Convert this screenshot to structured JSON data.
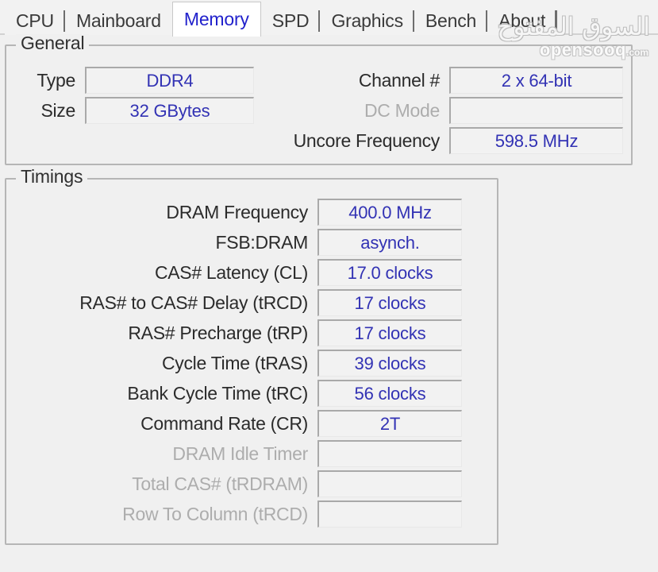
{
  "window": {
    "app": "CPU-Z",
    "active_tab": "Memory"
  },
  "tabs": [
    {
      "id": "cpu",
      "label": "CPU"
    },
    {
      "id": "mainboard",
      "label": "Mainboard"
    },
    {
      "id": "memory",
      "label": "Memory"
    },
    {
      "id": "spd",
      "label": "SPD"
    },
    {
      "id": "graphics",
      "label": "Graphics"
    },
    {
      "id": "bench",
      "label": "Bench"
    },
    {
      "id": "about",
      "label": "About"
    }
  ],
  "watermark": {
    "arabic": "السوق المفتوح",
    "english": "opensooq",
    "tld": ".com"
  },
  "general": {
    "legend": "General",
    "left": [
      {
        "label": "Type",
        "value": "DDR4",
        "disabled": false
      },
      {
        "label": "Size",
        "value": "32 GBytes",
        "disabled": false
      }
    ],
    "right": [
      {
        "label": "Channel #",
        "value": "2 x 64-bit",
        "disabled": false
      },
      {
        "label": "DC Mode",
        "value": "",
        "disabled": true
      },
      {
        "label": "Uncore Frequency",
        "value": "598.5 MHz",
        "disabled": false
      }
    ]
  },
  "timings": {
    "legend": "Timings",
    "rows": [
      {
        "label": "DRAM Frequency",
        "value": "400.0 MHz",
        "disabled": false
      },
      {
        "label": "FSB:DRAM",
        "value": "asynch.",
        "disabled": false
      },
      {
        "label": "CAS# Latency (CL)",
        "value": "17.0 clocks",
        "disabled": false
      },
      {
        "label": "RAS# to CAS# Delay (tRCD)",
        "value": "17 clocks",
        "disabled": false
      },
      {
        "label": "RAS# Precharge (tRP)",
        "value": "17 clocks",
        "disabled": false
      },
      {
        "label": "Cycle Time (tRAS)",
        "value": "39 clocks",
        "disabled": false
      },
      {
        "label": "Bank Cycle Time (tRC)",
        "value": "56 clocks",
        "disabled": false
      },
      {
        "label": "Command Rate (CR)",
        "value": "2T",
        "disabled": false
      },
      {
        "label": "DRAM Idle Timer",
        "value": "",
        "disabled": true
      },
      {
        "label": "Total CAS# (tRDRAM)",
        "value": "",
        "disabled": true
      },
      {
        "label": "Row To Column (tRCD)",
        "value": "",
        "disabled": true
      }
    ]
  },
  "colors": {
    "value_text": "#3232b4",
    "active_tab_text": "#2222cc",
    "label_text": "#2b2b2b",
    "disabled_text": "#adadad",
    "background": "#f0f0f0"
  }
}
